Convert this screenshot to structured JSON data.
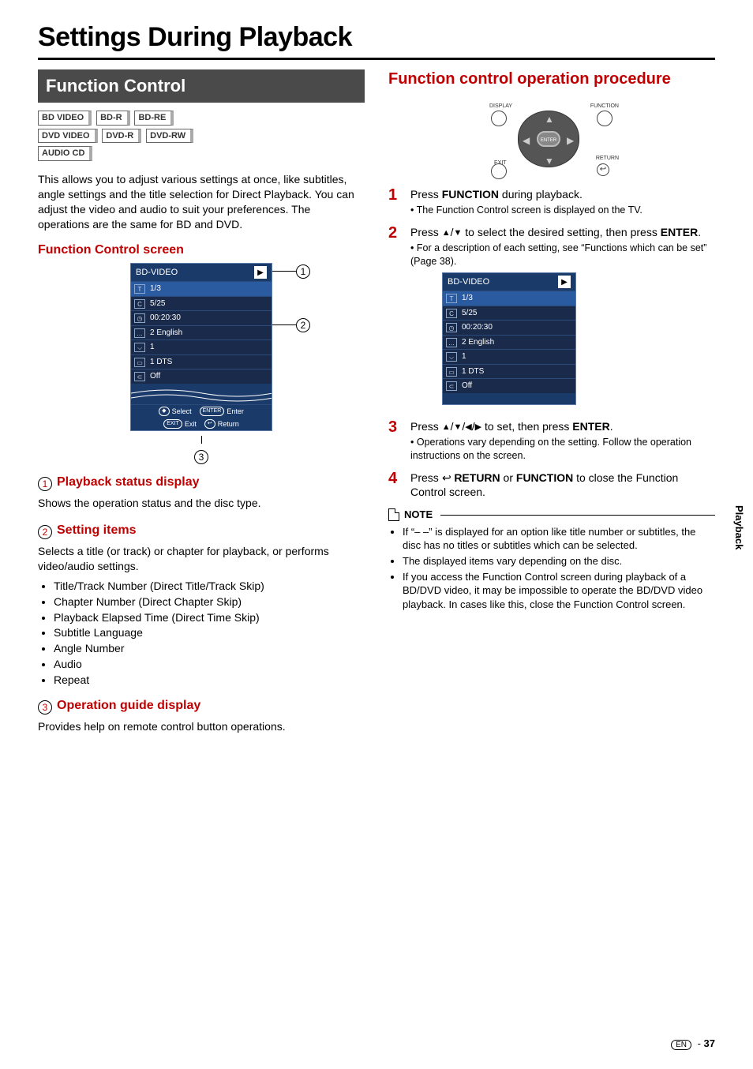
{
  "page_title": "Settings During Playback",
  "left": {
    "header": "Function Control",
    "tags": [
      "BD VIDEO",
      "BD-R",
      "BD-RE",
      "DVD VIDEO",
      "DVD-R",
      "DVD-RW",
      "AUDIO CD"
    ],
    "intro": "This allows you to adjust various settings at once, like subtitles, angle settings and the title selection for Direct Playback. You can adjust the video and audio to suit your preferences. The operations are the same for BD and DVD.",
    "sub_screen": "Function Control screen",
    "screen": {
      "title": "BD-VIDEO",
      "rows": [
        "1/3",
        "5/25",
        "00:20:30",
        "2 English",
        "1",
        "1 DTS",
        "Off"
      ],
      "guide": {
        "select": "Select",
        "enter": "Enter",
        "exit": "Exit",
        "return": "Return"
      },
      "callouts": [
        "1",
        "2",
        "3"
      ]
    },
    "sec1_title": "Playback status display",
    "sec1_body": "Shows the operation status and the disc type.",
    "sec2_title": "Setting items",
    "sec2_body": "Selects a title (or track) or chapter for playback, or performs video/audio settings.",
    "sec2_items": [
      "Title/Track Number (Direct Title/Track Skip)",
      "Chapter Number (Direct Chapter Skip)",
      "Playback Elapsed Time (Direct Time Skip)",
      "Subtitle Language",
      "Angle Number",
      "Audio",
      "Repeat"
    ],
    "sec3_title": "Operation guide display",
    "sec3_body": "Provides help on remote control button operations."
  },
  "right": {
    "header": "Function control operation procedure",
    "remote_labels": {
      "display": "DISPLAY",
      "function": "FUNCTION",
      "exit": "EXIT",
      "return": "RETURN",
      "enter": "ENTER"
    },
    "steps": [
      {
        "n": "1",
        "main_pre": "Press ",
        "main_bold": "FUNCTION",
        "main_post": " during playback.",
        "sub": "The Function Control screen is displayed on the TV."
      },
      {
        "n": "2",
        "main_html": "Press ▲/▼ to select the desired setting, then press <b>ENTER</b>.",
        "sub": "For a description of each setting, see “Functions which can be set” (Page 38)."
      },
      {
        "n": "3",
        "main_html": "Press ▲/▼/◀/▶ to set, then press <b>ENTER</b>.",
        "sub": "Operations vary depending on the setting. Follow the operation instructions on the screen."
      },
      {
        "n": "4",
        "main_html": "Press ↩ <b>RETURN</b> or <b>FUNCTION</b> to close the Function Control screen.",
        "sub": ""
      }
    ],
    "mini_screen": {
      "title": "BD-VIDEO",
      "rows": [
        "1/3",
        "5/25",
        "00:20:30",
        "2 English",
        "1",
        "1 DTS",
        "Off"
      ]
    },
    "note_label": "NOTE",
    "notes": [
      "If “– –” is displayed for an option like title number or subtitles, the disc has no titles or subtitles which can be selected.",
      "The displayed items vary depending on the disc.",
      "If you access the Function Control screen during playback of a BD/DVD video, it may be impossible to operate the BD/DVD video playback. In cases like this, close the Function Control screen."
    ]
  },
  "side_tab": "Playback",
  "footer_lang": "EN",
  "footer_page": "37"
}
